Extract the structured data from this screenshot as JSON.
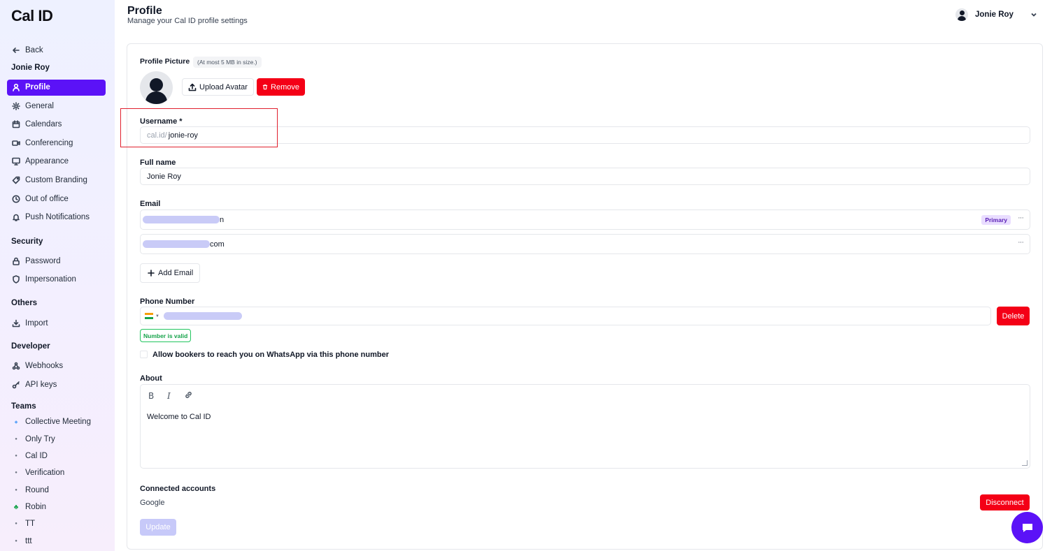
{
  "app": {
    "logo": "Cal ID"
  },
  "sidebar": {
    "back_label": "Back",
    "user_name": "Jonie Roy",
    "account_items": [
      {
        "label": "Profile",
        "icon": "user-icon",
        "active": true
      },
      {
        "label": "General",
        "icon": "gear-icon"
      },
      {
        "label": "Calendars",
        "icon": "calendar-icon"
      },
      {
        "label": "Conferencing",
        "icon": "video-icon"
      },
      {
        "label": "Appearance",
        "icon": "monitor-icon"
      },
      {
        "label": "Custom Branding",
        "icon": "tag-icon"
      },
      {
        "label": "Out of office",
        "icon": "clock-icon"
      },
      {
        "label": "Push Notifications",
        "icon": "bell-icon"
      }
    ],
    "security_heading": "Security",
    "security_items": [
      {
        "label": "Password",
        "icon": "lock-icon"
      },
      {
        "label": "Impersonation",
        "icon": "shield-icon"
      }
    ],
    "others_heading": "Others",
    "others_items": [
      {
        "label": "Import",
        "icon": "download-icon"
      }
    ],
    "developer_heading": "Developer",
    "developer_items": [
      {
        "label": "Webhooks",
        "icon": "webhook-icon"
      },
      {
        "label": "API keys",
        "icon": "key-icon"
      }
    ],
    "teams_heading": "Teams",
    "teams": [
      {
        "label": "Collective Meeting"
      },
      {
        "label": "Only Try"
      },
      {
        "label": "Cal ID"
      },
      {
        "label": "Verification"
      },
      {
        "label": "Round"
      },
      {
        "label": "Robin"
      },
      {
        "label": "TT"
      },
      {
        "label": "ttt"
      }
    ]
  },
  "header": {
    "title": "Profile",
    "subtitle": "Manage your Cal ID profile settings",
    "user_name": "Jonie Roy"
  },
  "profile": {
    "picture_label": "Profile Picture",
    "picture_note": "(At most 5 MB in size.)",
    "upload_label": "Upload Avatar",
    "remove_label": "Remove",
    "username_label": "Username *",
    "username_prefix": "cal.id/",
    "username_value": "jonie-roy",
    "fullname_label": "Full name",
    "fullname_value": "Jonie Roy",
    "email_label": "Email",
    "emails": [
      {
        "visible_part": "n",
        "badge": "Primary"
      },
      {
        "visible_part": "com",
        "badge": ""
      }
    ],
    "add_email_label": "Add Email",
    "phone_label": "Phone Number",
    "delete_label": "Delete",
    "phone_valid_text": "Number is valid",
    "whatsapp_label": "Allow bookers to reach you on WhatsApp via this phone number",
    "about_label": "About",
    "about_text": "Welcome to Cal ID",
    "connected_label": "Connected accounts",
    "connected_provider": "Google",
    "disconnect_label": "Disconnect",
    "update_label": "Update"
  },
  "colors": {
    "brand": "#5b12f7",
    "danger": "#f40016",
    "success": "#16a34a",
    "highlight": "#e0202e"
  }
}
